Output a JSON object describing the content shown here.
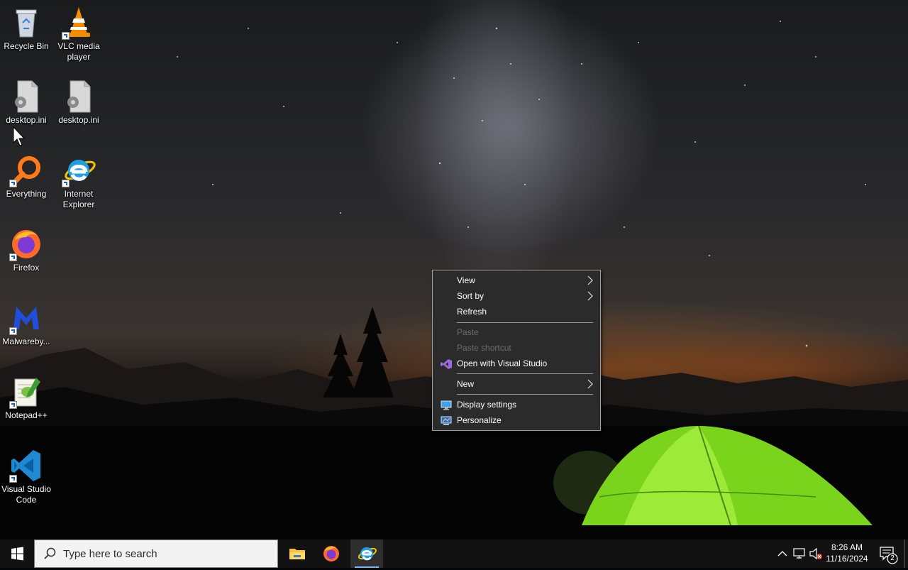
{
  "desktop": {
    "icons": [
      {
        "label": "Recycle Bin",
        "icon": "recycle-bin-icon"
      },
      {
        "label": "VLC media player",
        "icon": "vlc-icon"
      },
      {
        "label": "desktop.ini",
        "icon": "settings-file-icon"
      },
      {
        "label": "desktop.ini",
        "icon": "settings-file-icon"
      },
      {
        "label": "Everything",
        "icon": "everything-search-icon"
      },
      {
        "label": "Internet Explorer",
        "icon": "internet-explorer-icon"
      },
      {
        "label": "Firefox",
        "icon": "firefox-icon"
      },
      {
        "label": "Malwareby...",
        "icon": "malwarebytes-icon"
      },
      {
        "label": "Notepad++",
        "icon": "notepadpp-icon"
      },
      {
        "label": "Visual Studio Code",
        "icon": "vscode-icon"
      }
    ]
  },
  "context_menu": {
    "view": "View",
    "sort_by": "Sort by",
    "refresh": "Refresh",
    "paste": "Paste",
    "paste_shortcut": "Paste shortcut",
    "open_with_vs": "Open with Visual Studio",
    "new": "New",
    "display_settings": "Display settings",
    "personalize": "Personalize"
  },
  "taskbar": {
    "search_placeholder": "Type here to search",
    "pinned": [
      "File Explorer",
      "Firefox",
      "Internet Explorer"
    ],
    "active": "Internet Explorer",
    "clock": {
      "time": "8:26 AM",
      "date": "11/16/2024"
    },
    "notification_count": "2"
  },
  "colors": {
    "menu_bg": "#2b2b2b",
    "taskbar_bg": "#121212",
    "accent": "#7fb4ff"
  }
}
